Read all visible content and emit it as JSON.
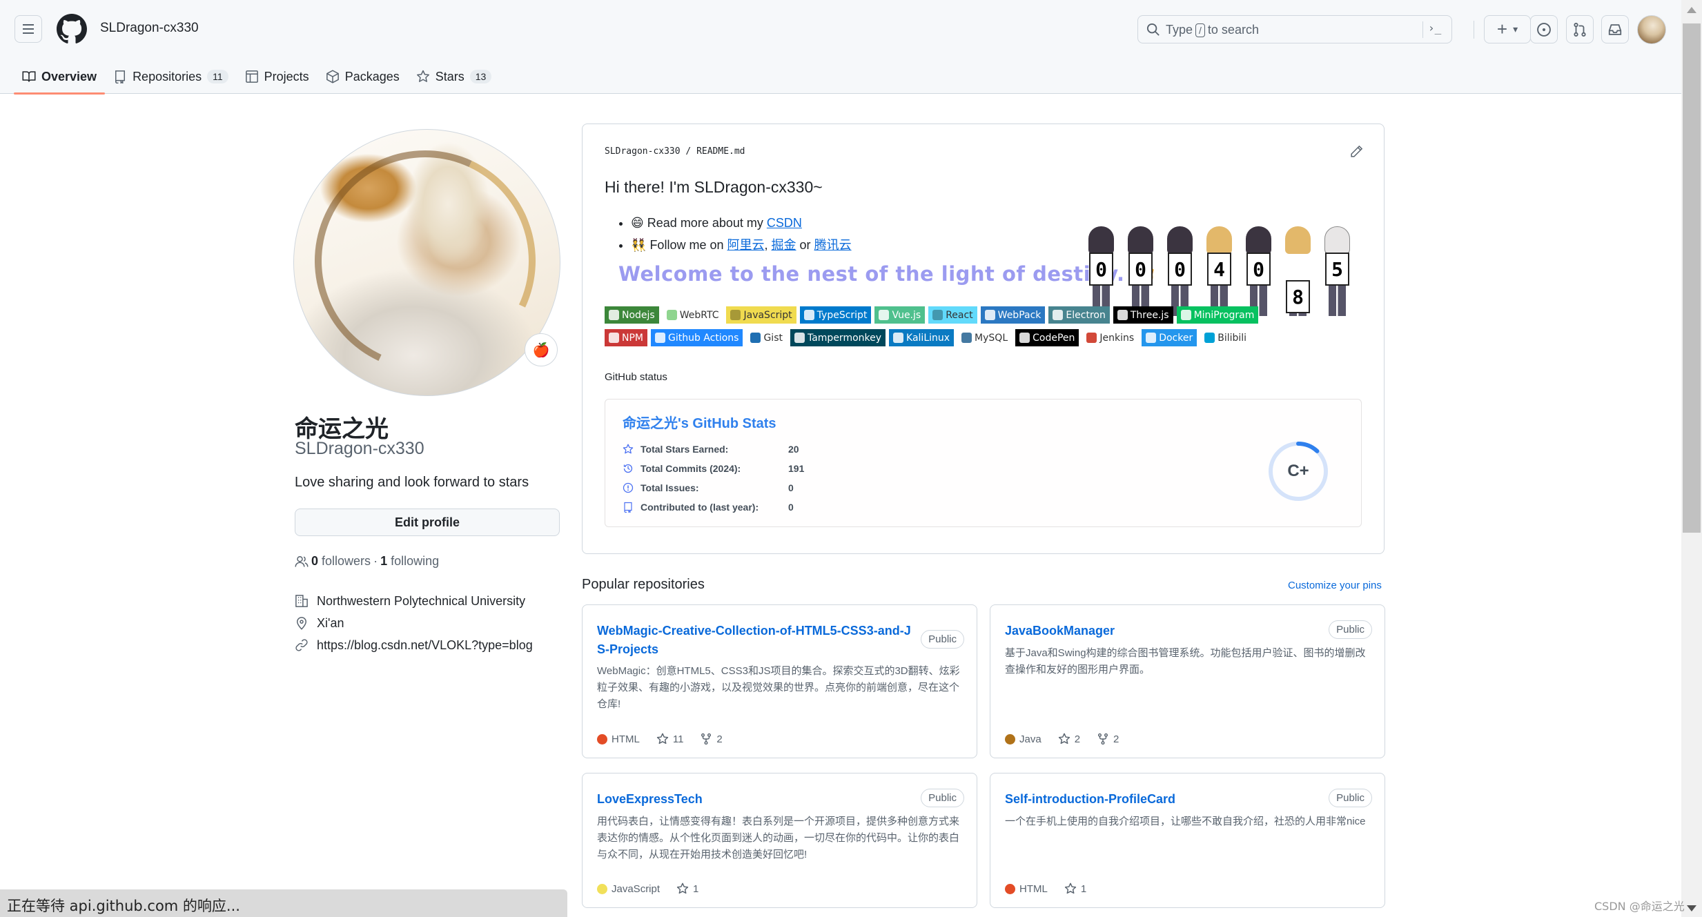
{
  "header": {
    "owner": "SLDragon-cx330",
    "search_placeholder_pre": "Type",
    "search_key": "/",
    "search_placeholder_post": "to search",
    "command_glyph": "›_",
    "new_label": "+",
    "new_dropdown": "▾"
  },
  "tabs": [
    {
      "label": "Overview",
      "icon": "book-icon",
      "active": true
    },
    {
      "label": "Repositories",
      "icon": "repo-icon",
      "count": "11"
    },
    {
      "label": "Projects",
      "icon": "table-icon"
    },
    {
      "label": "Packages",
      "icon": "package-icon"
    },
    {
      "label": "Stars",
      "icon": "star-icon",
      "count": "13"
    }
  ],
  "profile": {
    "display_name": "命运之光",
    "login": "SLDragon-cx330",
    "bio": "Love sharing and look forward to stars",
    "status_emoji": "🍎",
    "edit_label": "Edit profile",
    "followers_count": "0",
    "followers_label": "followers",
    "separator": "·",
    "following_count": "1",
    "following_label": "following",
    "organization": "Northwestern Polytechnical University",
    "location": "Xi'an",
    "website": "https://blog.csdn.net/VLOKL?type=blog"
  },
  "readme": {
    "path_owner": "SLDragon-cx330",
    "path_sep": "/",
    "path_file": "README.md",
    "heading": "Hi there! I'm SLDragon-cx330~",
    "line1_emoji": "😄",
    "line1_text": "Read more about my",
    "line1_link": "CSDN",
    "line2_emoji": "👯",
    "line2_text": "Follow me on",
    "line2_link1": "阿里云",
    "line2_comma": ",",
    "line2_link2": "掘金",
    "line2_or": "or",
    "line2_link3": "腾讯云",
    "welcome": "Welcome to the nest of the light of destiny. 👋",
    "visit_counter": [
      "0",
      "0",
      "0",
      "4",
      "0",
      "8",
      "5"
    ],
    "badges_row1": [
      {
        "label": "Nodejs",
        "bg": "#3c873a"
      },
      {
        "label": "WebRTC",
        "bg": "#ffffff",
        "icon_bg": "#8fd58f",
        "light": true
      },
      {
        "label": "JavaScript",
        "bg": "#f0db4f",
        "light": true
      },
      {
        "label": "TypeScript",
        "bg": "#007acc"
      },
      {
        "label": "Vue.js",
        "bg": "#4fc08d",
        "prefix": "V"
      },
      {
        "label": "React",
        "bg": "#61dafb",
        "light": true
      },
      {
        "label": "WebPack",
        "bg": "#2b78c2"
      },
      {
        "label": "Electron",
        "bg": "#47848f"
      },
      {
        "label": "Three.js",
        "bg": "#000000"
      },
      {
        "label": "MiniProgram",
        "bg": "#07c160"
      }
    ],
    "badges_row2": [
      {
        "label": "NPM",
        "bg": "#cb3837"
      },
      {
        "label": "Github Actions",
        "bg": "#2088ff"
      },
      {
        "label": "Gist",
        "bg": "#ffffff",
        "icon_bg": "#1f6fb2",
        "light": true
      },
      {
        "label": "Tampermonkey",
        "bg": "#00485b"
      },
      {
        "label": "KaliLinux",
        "bg": "#0a7ac2"
      },
      {
        "label": "MySQL",
        "bg": "#ffffff",
        "icon_bg": "#4479a1",
        "light": true
      },
      {
        "label": "CodePen",
        "bg": "#000000"
      },
      {
        "label": "Jenkins",
        "bg": "#ffffff",
        "icon_bg": "#d24939",
        "light": true
      },
      {
        "label": "Docker",
        "bg": "#2496ed"
      },
      {
        "label": "Bilibili",
        "bg": "#ffffff",
        "icon_bg": "#00a1d6",
        "light": true
      }
    ],
    "status_heading": "GitHub status",
    "stats": {
      "title_name": "命运之光",
      "title_suffix": "'s GitHub Stats",
      "rows": [
        {
          "label": "Total Stars Earned:",
          "value": "20",
          "icon": "star-icon"
        },
        {
          "label": "Total Commits (2024):",
          "value": "191",
          "icon": "history-icon"
        },
        {
          "label": "Total Issues:",
          "value": "0",
          "icon": "issue-icon"
        },
        {
          "label": "Contributed to (last year):",
          "value": "0",
          "icon": "repo-icon"
        }
      ],
      "rank": "C+",
      "rank_progress": 0.12,
      "accent": "#2f80ed"
    }
  },
  "popular": {
    "title": "Popular repositories",
    "customize": "Customize your pins",
    "repos": [
      {
        "name": "WebMagic-Creative-Collection-of-HTML5-CSS3-and-JS-Projects",
        "visibility": "Public",
        "description": "WebMagic：创意HTML5、CSS3和JS项目的集合。探索交互式的3D翻转、炫彩粒子效果、有趣的小游戏，以及视觉效果的世界。点亮你的前端创意，尽在这个仓库!",
        "language": "HTML",
        "lang_color": "#e34c26",
        "stars": "11",
        "forks": "2"
      },
      {
        "name": "JavaBookManager",
        "visibility": "Public",
        "description": "基于Java和Swing构建的综合图书管理系统。功能包括用户验证、图书的增删改查操作和友好的图形用户界面。",
        "language": "Java",
        "lang_color": "#b07219",
        "stars": "2",
        "forks": "2"
      },
      {
        "name": "LoveExpressTech",
        "visibility": "Public",
        "description": "用代码表白，让情感变得有趣！表白系列是一个开源项目，提供多种创意方式来表达你的情感。从个性化页面到迷人的动画，一切尽在你的代码中。让你的表白与众不同，从现在开始用技术创造美好回忆吧!",
        "language": "JavaScript",
        "lang_color": "#f1e05a",
        "stars": "1"
      },
      {
        "name": "Self-introduction-ProfileCard",
        "visibility": "Public",
        "description": "一个在手机上使用的自我介绍项目，让哪些不敢自我介绍，社恐的人用非常nice",
        "language": "HTML",
        "lang_color": "#e34c26",
        "stars": "1"
      }
    ]
  },
  "browser": {
    "status_text": "正在等待 api.github.com 的响应...",
    "watermark": "CSDN @命运之光"
  }
}
